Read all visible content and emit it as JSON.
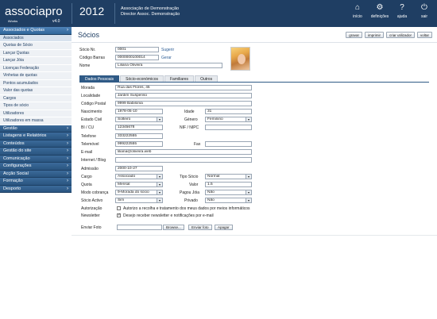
{
  "app": {
    "name": "associapro",
    "sub": "iWorks",
    "version": "v4.0",
    "year": "2012",
    "assoc_name": "Associação de Demonstração",
    "user_role": "Director Assoc. Demonstração"
  },
  "topnav": [
    {
      "label": "início",
      "icon": "home-icon"
    },
    {
      "label": "definições",
      "icon": "gear-icon"
    },
    {
      "label": "ajuda",
      "icon": "help-icon"
    },
    {
      "label": "sair",
      "icon": "power-icon"
    }
  ],
  "sidebar": {
    "open_section": "Associados e Quotas",
    "open_items": [
      "Associados",
      "Quotas de Sócio",
      "Lançar Quotas",
      "Lançar Jóia",
      "Licenças Federação",
      "Vinhetas de quotas",
      "Pontos acumulados",
      "Valor das quotas",
      "Cargos",
      "Tipos de sócio",
      "Utilizadores",
      "Utilizadores em massa"
    ],
    "sections": [
      "Gestão",
      "Listagens e Relatórios",
      "Conteúdos",
      "Gestão do site",
      "Comunicação",
      "Configurações",
      "Acção Social",
      "Formação",
      "Desporto"
    ]
  },
  "page": {
    "title": "Sócios",
    "actions": [
      "gravar",
      "imprimir",
      "criar utilizador",
      "voltar"
    ]
  },
  "form": {
    "socio_nr_label": "Sócio Nr.",
    "socio_nr": "0001",
    "sugerir": "Sugerir",
    "codigo_barras_label": "Código Barras",
    "codigo_barras": "0000000100014",
    "gerar": "Gerar",
    "nome_label": "Nome",
    "nome": "Liliana Oliveira",
    "tabs": [
      "Dados Pessoais",
      "Sócio-económicos",
      "Familiares",
      "Outros"
    ],
    "morada_label": "Morada",
    "morada": "Rua das Flores, 45",
    "localidade_label": "Localidade",
    "localidade": "Jardim Suspenso",
    "codigo_postal_label": "Código Postal",
    "codigo_postal": "9999 Babilonia",
    "nascimento_label": "Nascimento",
    "nascimento": "1978-05-10",
    "idade_label": "Idade",
    "idade": "31",
    "estado_civil_label": "Estado Civil",
    "estado_civil": "Solteiro",
    "genero_label": "Género",
    "genero": "Feminino",
    "bi_label": "BI / CU",
    "bi": "12345678",
    "nif_label": "NIF / NIPC",
    "nif": "",
    "telefone_label": "Telefone",
    "telefone": "333222555",
    "telemovel_label": "Telemóvel",
    "telemovel": "999222555",
    "fax_label": "Fax",
    "fax": "",
    "email_label": "E-mail",
    "email": "liliana@oliveira.web",
    "internet_label": "Internet / Blog",
    "internet": "",
    "admissao_label": "Admissão",
    "admissao": "2000-10-27",
    "cargo_label": "Cargo",
    "cargo": "Associado",
    "tipo_socio_label": "Tipo Sócio",
    "tipo_socio": "Normal",
    "quota_label": "Quota",
    "quota": "Mensal",
    "valor_label": "Valor",
    "valor": "1.5",
    "modo_cobranca_label": "Modo cobrança",
    "modo_cobranca": "9-Morada do sócio",
    "pagou_joia_label": "Pagou Jóia",
    "pagou_joia": "Não",
    "socio_activo_label": "Sócio Activo",
    "socio_activo": "Sim",
    "privado_label": "Privado",
    "privado": "Não",
    "autorizacao_label": "Autorização",
    "autorizacao_text": "Autorizo a recolha e tratamento dos meus dados por meios informáticos",
    "newsletter_label": "Newsletter",
    "newsletter_text": "Desejo receber newsletter e notificações por e-mail",
    "enviar_foto_label": "Enviar Foto",
    "browse": "Browse...",
    "enviar_foto_btn": "Enviar foto",
    "apagar": "Apagar"
  }
}
